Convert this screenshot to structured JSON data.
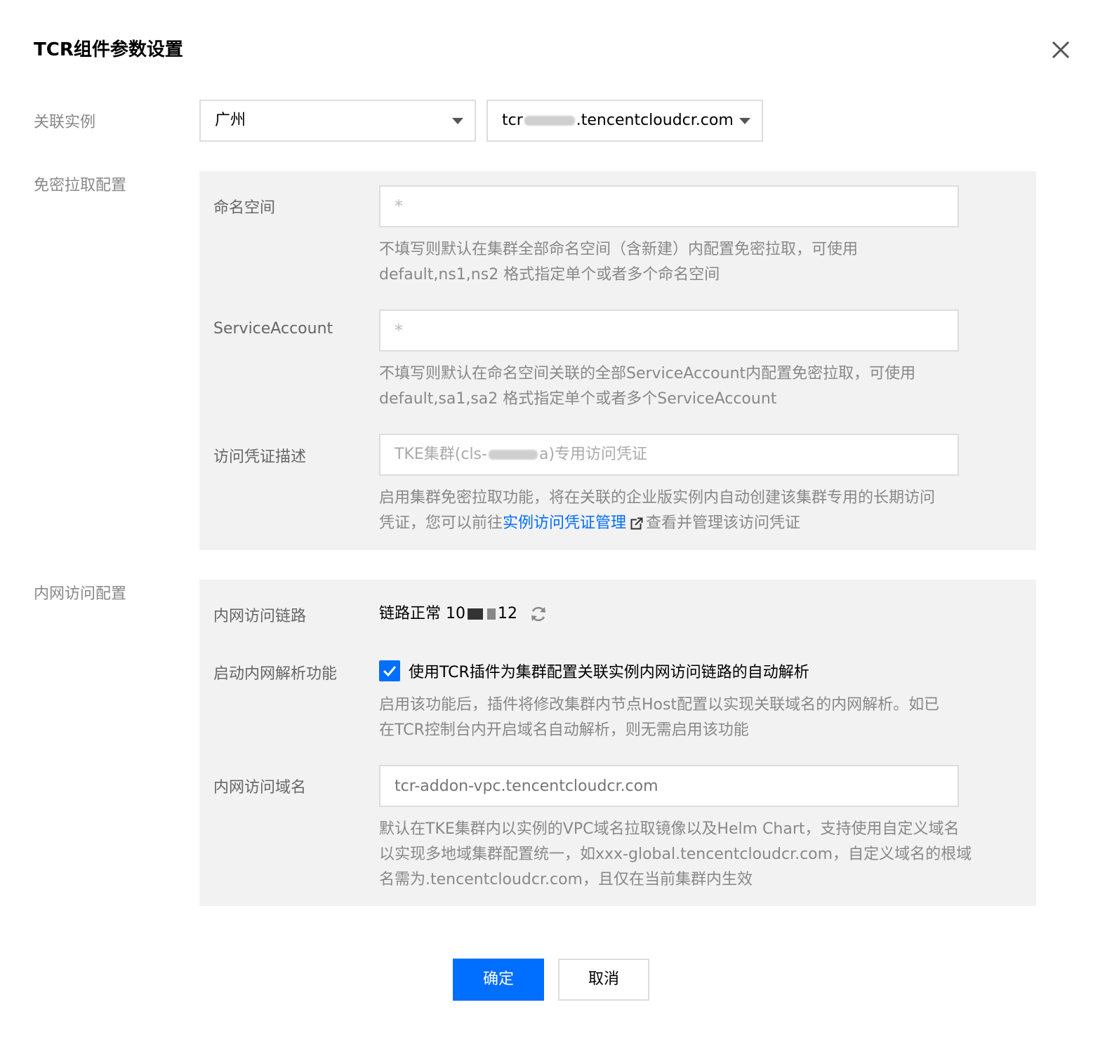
{
  "dialog": {
    "title": "TCR组件参数设置"
  },
  "instance": {
    "label": "关联实例",
    "region_value": "广州",
    "domain_prefix": "tcr",
    "domain_suffix": ".tencentcloudcr.com"
  },
  "pull_config": {
    "label": "免密拉取配置",
    "namespace": {
      "label": "命名空间",
      "value": "*",
      "help_line1": "不填写则默认在集群全部命名空间（含新建）内配置免密拉取，可使用",
      "help_line2": "default,ns1,ns2 格式指定单个或者多个命名空间"
    },
    "service_account": {
      "label": "ServiceAccount",
      "value": "*",
      "help_line1": "不填写则默认在命名空间关联的全部ServiceAccount内配置免密拉取，可使用",
      "help_line2": "default,sa1,sa2 格式指定单个或者多个ServiceAccount"
    },
    "credential": {
      "label": "访问凭证描述",
      "placeholder_prefix": "TKE集群(cls-",
      "placeholder_suffix": "a)专用访问凭证",
      "help_line1": "启用集群免密拉取功能，将在关联的企业版实例内自动创建该集群专用的长期访问",
      "help_line2_pre": "凭证，您可以前往",
      "help_link": "实例访问凭证管理",
      "help_line2_post": "查看并管理该访问凭证"
    }
  },
  "vpc_config": {
    "label": "内网访问配置",
    "link": {
      "label": "内网访问链路",
      "status": "链路正常",
      "ip_prefix": "10",
      "ip_suffix": "12"
    },
    "dns": {
      "label": "启动内网解析功能",
      "checked": true,
      "checkbox_label": "使用TCR插件为集群配置关联实例内网访问链路的自动解析",
      "help_line1": "启用该功能后，插件将修改集群内节点Host配置以实现关联域名的内网解析。如已",
      "help_line2": "在TCR控制台内开启域名自动解析，则无需启用该功能"
    },
    "domain": {
      "label": "内网访问域名",
      "placeholder": "tcr-addon-vpc.tencentcloudcr.com",
      "help_line1": "默认在TKE集群内以实例的VPC域名拉取镜像以及Helm Chart，支持使用自定义域名",
      "help_line2": "以实现多地域集群配置统一，如xxx-global.tencentcloudcr.com，自定义域名的根域",
      "help_line3": "名需为.tencentcloudcr.com，且仅在当前集群内生效"
    }
  },
  "footer": {
    "confirm_label": "确定",
    "cancel_label": "取消"
  },
  "colors": {
    "primary": "#006eff",
    "panel_bg": "#f2f2f2",
    "label_gray": "#888888"
  },
  "icons": [
    "close-icon",
    "caret-down-icon",
    "external-link-icon",
    "refresh-icon",
    "check-icon"
  ]
}
